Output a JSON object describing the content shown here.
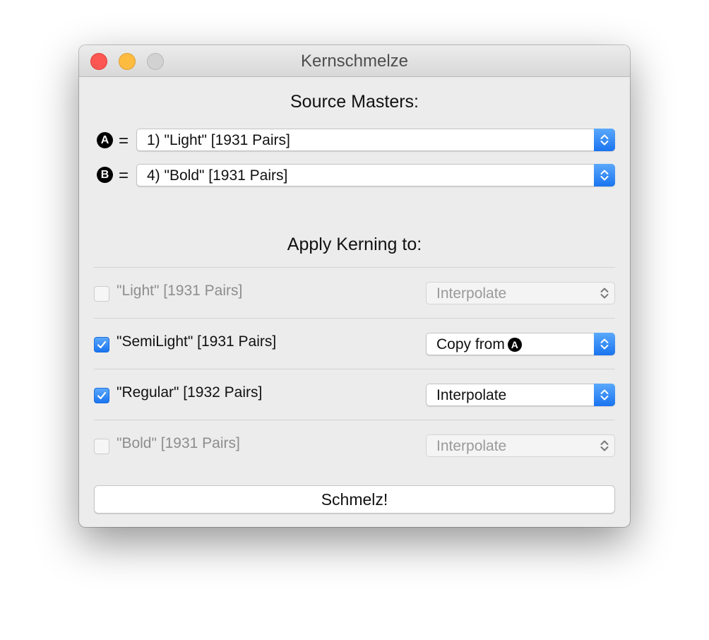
{
  "window": {
    "title": "Kernschmelze"
  },
  "source": {
    "heading": "Source Masters:",
    "equals": "=",
    "master_a": {
      "badge": "A",
      "value": "1)  \"Light\"  [1931 Pairs]"
    },
    "master_b": {
      "badge": "B",
      "value": "4)  \"Bold\"  [1931 Pairs]"
    }
  },
  "apply": {
    "heading": "Apply Kerning to:",
    "rows": [
      {
        "label": "\"Light\"  [1931 Pairs]",
        "checked": false,
        "enabled": false,
        "method": "Interpolate"
      },
      {
        "label": "\"SemiLight\"  [1931 Pairs]",
        "checked": true,
        "enabled": true,
        "method": "Copy from",
        "method_badge": "A"
      },
      {
        "label": "\"Regular\"  [1932 Pairs]",
        "checked": true,
        "enabled": true,
        "method": "Interpolate"
      },
      {
        "label": "\"Bold\"  [1931 Pairs]",
        "checked": false,
        "enabled": false,
        "method": "Interpolate"
      }
    ]
  },
  "action": {
    "label": "Schmelz!"
  },
  "colors": {
    "accent": "#1a74f0",
    "close": "#fc5753",
    "minimize": "#fdbc40",
    "zoom_inactive": "#d2d2d2"
  }
}
